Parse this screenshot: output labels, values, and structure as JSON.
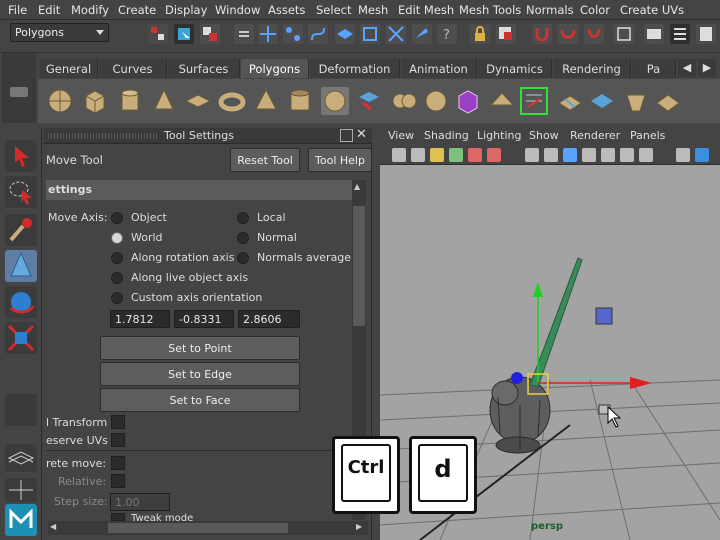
{
  "menubar": {
    "items": [
      "File",
      "Edit",
      "Modify",
      "Create",
      "Display",
      "Window",
      "Assets",
      "Select",
      "Mesh",
      "Edit Mesh",
      "Mesh Tools",
      "Normals",
      "Color",
      "Create UVs"
    ]
  },
  "statusline": {
    "menu_set": "Polygons"
  },
  "shelf": {
    "tabs": [
      "General",
      "Curves",
      "Surfaces",
      "Polygons",
      "Deformation",
      "Animation",
      "Dynamics",
      "Rendering",
      "Pa"
    ],
    "active_tab": "Polygons"
  },
  "tool_settings": {
    "panel_title": "Tool Settings",
    "tool_name": "Move Tool",
    "reset_label": "Reset Tool",
    "help_label": "Tool Help",
    "section_title": "ettings",
    "move_axis_label": "Move Axis:",
    "axis_options": {
      "object": "Object",
      "local": "Local",
      "world": "World",
      "normal": "Normal",
      "along_rotation": "Along rotation axis",
      "normals_average": "Normals average",
      "along_live": "Along live object axis",
      "custom": "Custom axis orientation"
    },
    "selected_axis": "World",
    "axis_values": [
      "1.7812",
      "-0.8331",
      "2.8606"
    ],
    "set_to_point": "Set to Point",
    "set_to_edge": "Set to Edge",
    "set_to_face": "Set to Face",
    "transform_label": "l Transform",
    "preserve_uvs_label": "eserve UVs",
    "discrete_move_label": "rete move:",
    "relative_label": "Relative:",
    "step_size_label": "Step size:",
    "step_size_value": "1.00",
    "tweak_mode_label": "Tweak mode"
  },
  "viewport": {
    "menu": [
      "View",
      "Shading",
      "Lighting",
      "Show",
      "Renderer",
      "Panels"
    ],
    "camera_label": "persp",
    "colors": {
      "x_axis": "#e02020",
      "y_axis": "#20d020",
      "z_axis": "#2020e0",
      "background": "#a3a3a3"
    }
  },
  "overlay": {
    "keys": [
      "Ctrl",
      "d"
    ]
  },
  "icons": {
    "select": "arrow-select-icon",
    "lasso": "lasso-select-icon",
    "paint": "paint-select-icon",
    "move": "move-tool-icon",
    "rotate": "rotate-tool-icon",
    "scale": "scale-tool-icon"
  }
}
